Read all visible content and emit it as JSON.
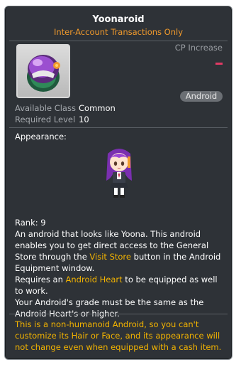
{
  "item": {
    "name": "Yoonaroid",
    "trade_restriction": "Inter-Account Transactions Only",
    "cp_increase_label": "CP Increase",
    "cp_increase_value": "-",
    "category_badge": "Android",
    "available_class_label": "Available Class",
    "available_class_value": "Common",
    "required_level_label": "Required Level",
    "required_level_value": "10",
    "appearance_label": "Appearance:"
  },
  "description": {
    "rank": "Rank: 9",
    "p1_a": "An android that looks like Yoona. This android enables you to get direct access to the General Store through the ",
    "p1_link": "Visit Store",
    "p1_b": " button in the Android Equipment window.",
    "p2_a": "Requires an ",
    "p2_link": "Android Heart",
    "p2_b": " to be equipped as well to work.",
    "p3": "Your Android's grade must be the same as the Android Heart's or higher."
  },
  "note": "This is a non-humanoid Android, so you can't customize its Hair or Face, and its appearance will not change even when equipped with a cash item.",
  "colors": {
    "background": "#2e3237",
    "title": "#ffffff",
    "restriction": "#f19a2c",
    "highlight": "#f4b400",
    "cp_dash": "#e23a64",
    "muted": "#9a9ea3"
  },
  "icons": [
    "android-item-icon",
    "android-character-sprite"
  ]
}
